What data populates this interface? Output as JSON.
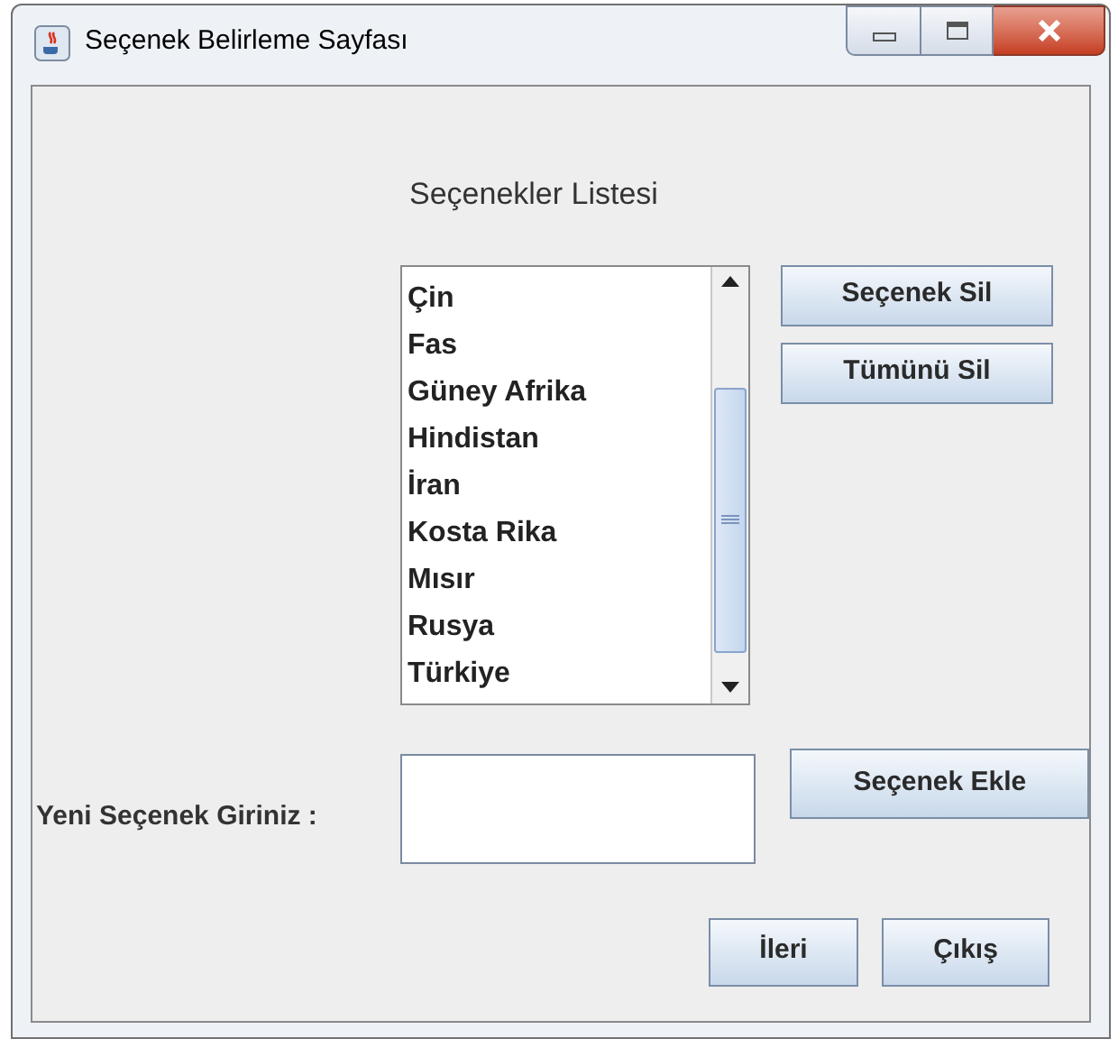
{
  "window": {
    "title": "Seçenek Belirleme Sayfası"
  },
  "list_title": "Seçenekler Listesi",
  "options": [
    "Çin",
    "Fas",
    "Güney Afrika",
    "Hindistan",
    "İran",
    "Kosta Rika",
    "Mısır",
    "Rusya",
    "Türkiye"
  ],
  "side_buttons": [
    "Seçenek Sil",
    "Tümünü Sil"
  ],
  "new_option": {
    "label": "Yeni Seçenek Giriniz :",
    "button": "Seçenek Ekle"
  },
  "footer_buttons": [
    "İleri",
    "Çıkış"
  ]
}
